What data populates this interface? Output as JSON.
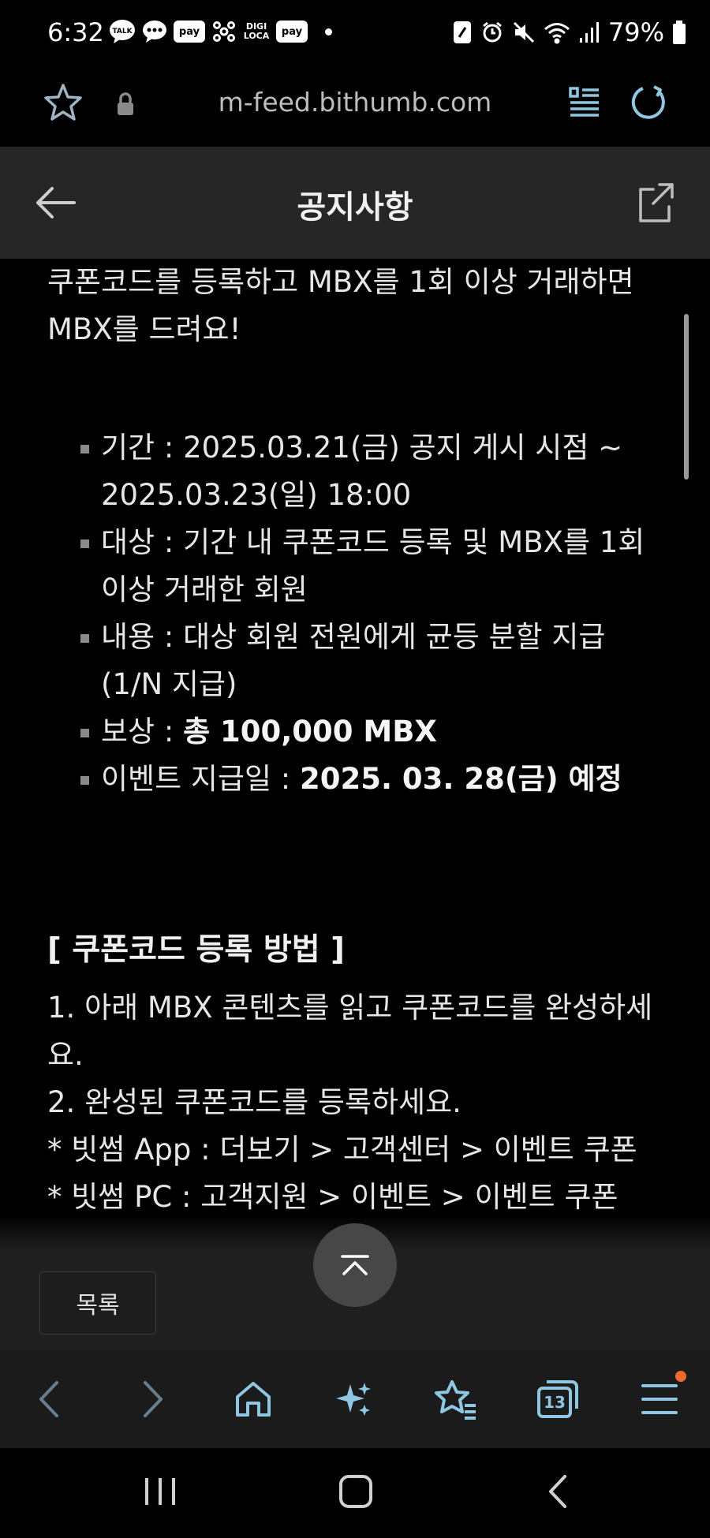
{
  "status_bar": {
    "time": "6:32",
    "notifications": [
      {
        "name": "talk-icon",
        "label": "TALK"
      },
      {
        "name": "chat-bubble-icon",
        "label": ""
      },
      {
        "name": "pay-icon",
        "label": "pay"
      },
      {
        "name": "network-share-icon",
        "label": ""
      },
      {
        "name": "digi-loca-icon",
        "label": "DIGI LOCA"
      },
      {
        "name": "pay-icon",
        "label": "pay"
      }
    ],
    "battery_percent": "79%"
  },
  "address_bar": {
    "url": "m-feed.bithumb.com"
  },
  "page_header": {
    "title": "공지사항"
  },
  "content": {
    "intro": "쿠폰코드를 등록하고 MBX를 1회 이상 거래하면 MBX를 드려요!",
    "bullets": [
      {
        "label": "기간 : ",
        "value": "2025.03.21(금) 공지 게시 시점 ~ 2025.03.23(일) 18:00",
        "bold": ""
      },
      {
        "label": "대상 : ",
        "value": "기간 내 쿠폰코드 등록 및 MBX를 1회 이상 거래한 회원",
        "bold": ""
      },
      {
        "label": "내용 : ",
        "value": "대상 회원 전원에게 균등 분할 지급 (1/N 지급)",
        "bold": ""
      },
      {
        "label": "보상 : ",
        "value": "",
        "bold": "총 100,000 MBX"
      },
      {
        "label": "이벤트 지급일 : ",
        "value": "",
        "bold": "2025. 03. 28(금) 예정"
      }
    ],
    "section_title": "[ 쿠폰코드 등록 방법 ]",
    "steps": [
      "1. 아래 MBX 콘텐츠를 읽고 쿠폰코드를 완성하세요.",
      "2. 완성된 쿠폰코드를 등록하세요.",
      "* 빗썸 App : 더보기 > 고객센터 > 이벤트 쿠폰",
      "* 빗썸 PC : 고객지원 > 이벤트 > 이벤트 쿠폰"
    ]
  },
  "list_button_label": "목록",
  "browser_toolbar": {
    "tab_count": "13",
    "accent_color": "#8fc7e3",
    "badge_color": "#f06a2f"
  }
}
